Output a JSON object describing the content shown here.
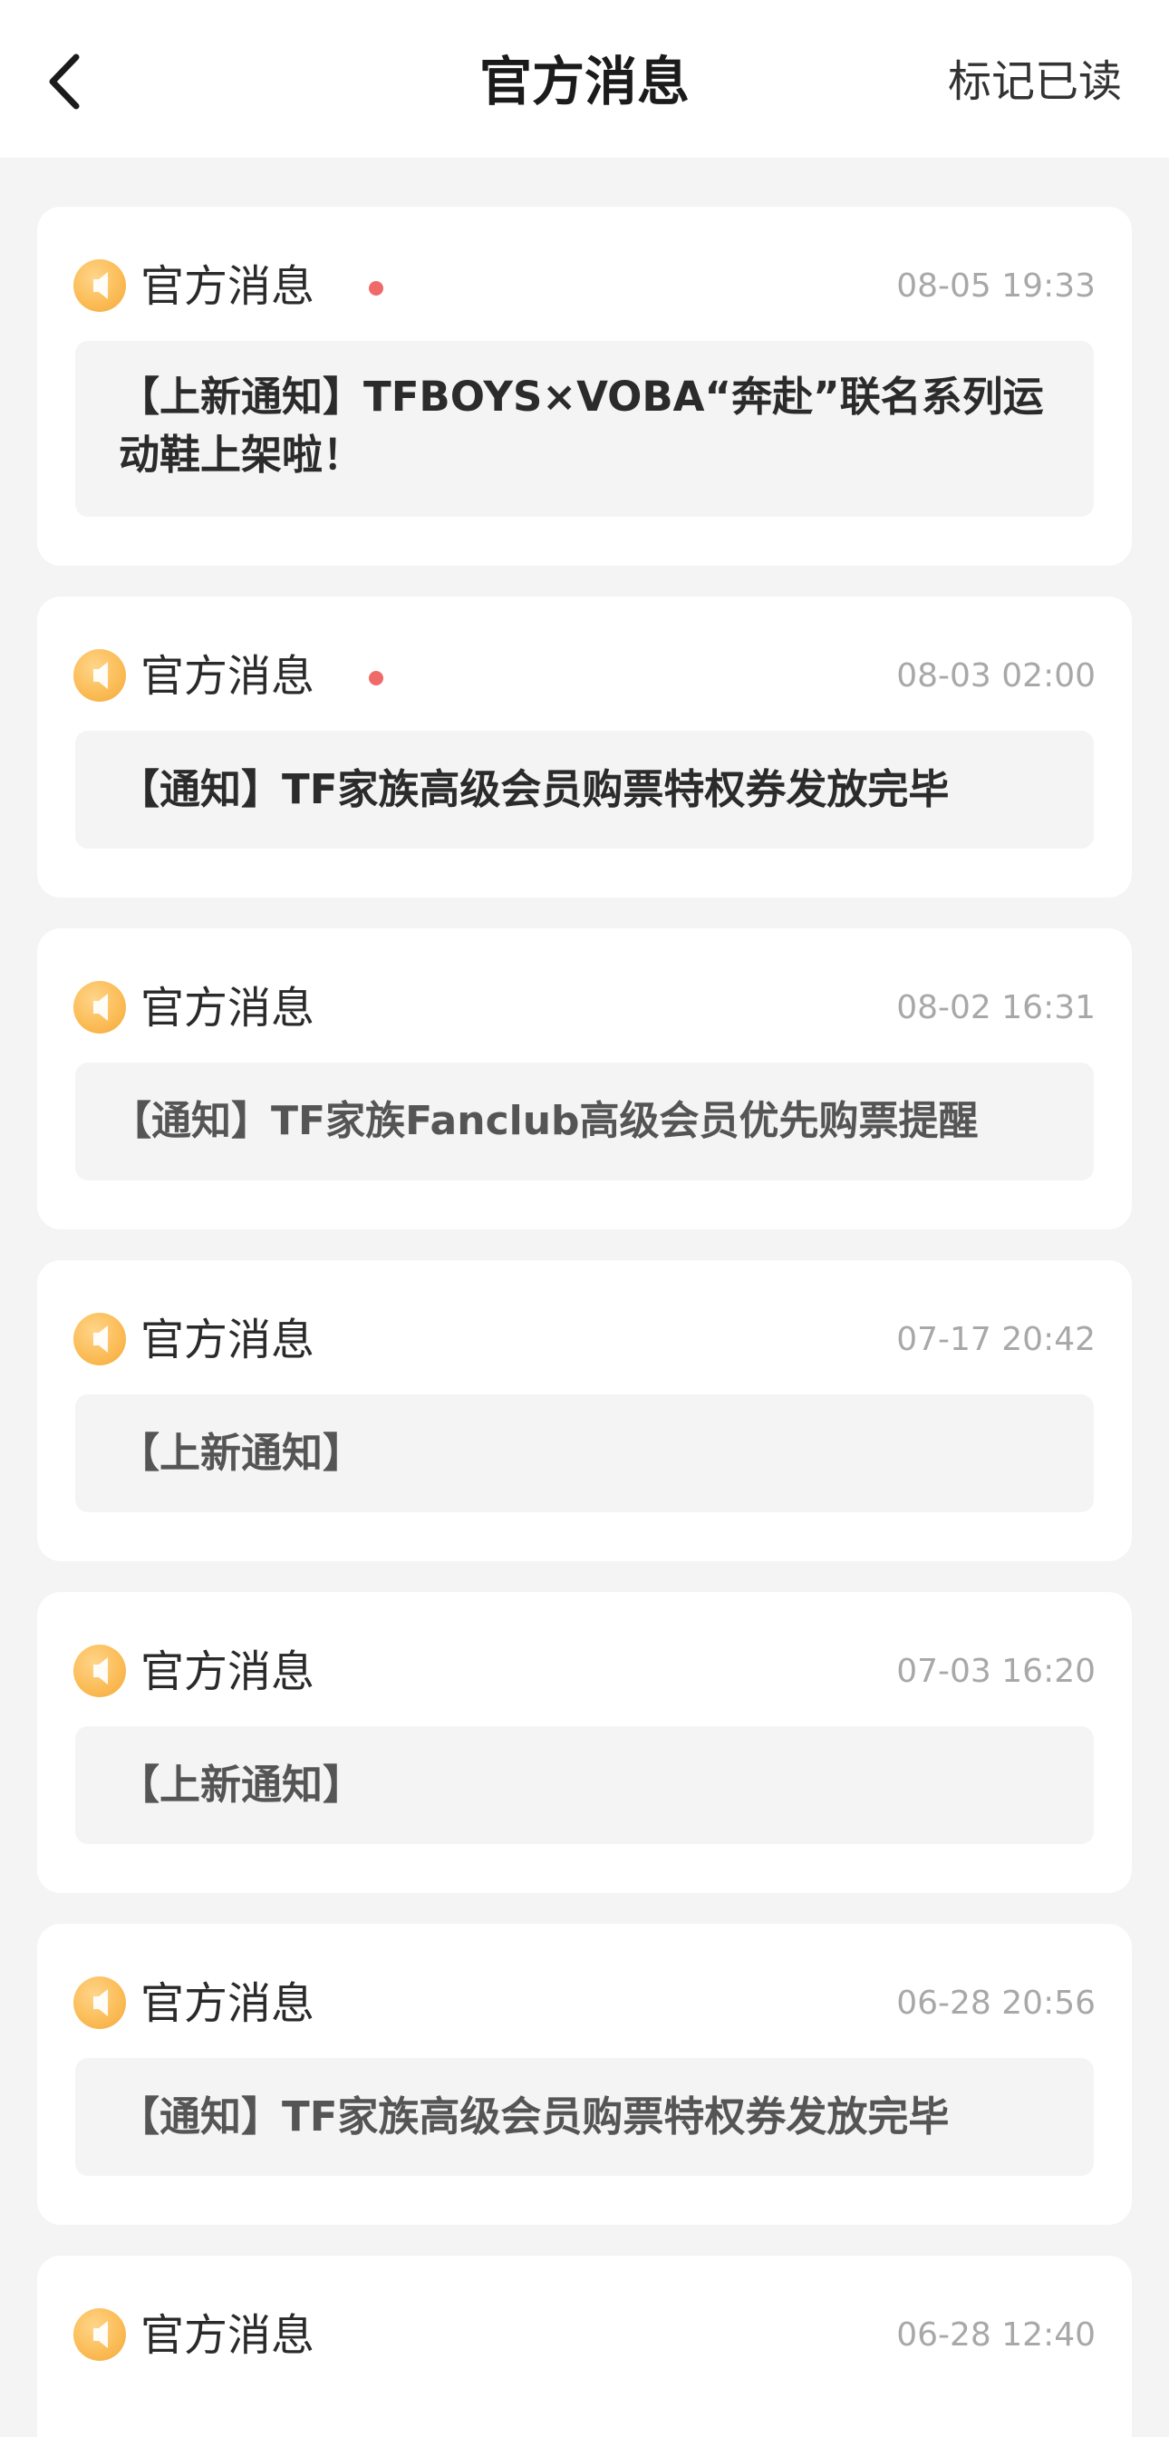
{
  "header": {
    "title": "官方消息",
    "mark_read_label": "标记已读"
  },
  "colors": {
    "unread_dot": "#f06a6a",
    "icon_orange": "#fbbd58",
    "background": "#f4f4f4"
  },
  "messages": [
    {
      "sender": "官方消息",
      "unread": true,
      "time": "08-05 19:33",
      "content": "【上新通知】TFBOYS×VOBA“奔赴”联名系列运动鞋上架啦！"
    },
    {
      "sender": "官方消息",
      "unread": true,
      "time": "08-03 02:00",
      "content": "【通知】TF家族高级会员购票特权券发放完毕"
    },
    {
      "sender": "官方消息",
      "unread": false,
      "time": "08-02 16:31",
      "content": "【通知】TF家族Fanclub高级会员优先购票提醒"
    },
    {
      "sender": "官方消息",
      "unread": false,
      "time": "07-17 20:42",
      "content": "【上新通知】"
    },
    {
      "sender": "官方消息",
      "unread": false,
      "time": "07-03 16:20",
      "content": "【上新通知】"
    },
    {
      "sender": "官方消息",
      "unread": false,
      "time": "06-28 20:56",
      "content": "【通知】TF家族高级会员购票特权券发放完毕"
    },
    {
      "sender": "官方消息",
      "unread": false,
      "time": "06-28 12:40",
      "content": ""
    }
  ]
}
